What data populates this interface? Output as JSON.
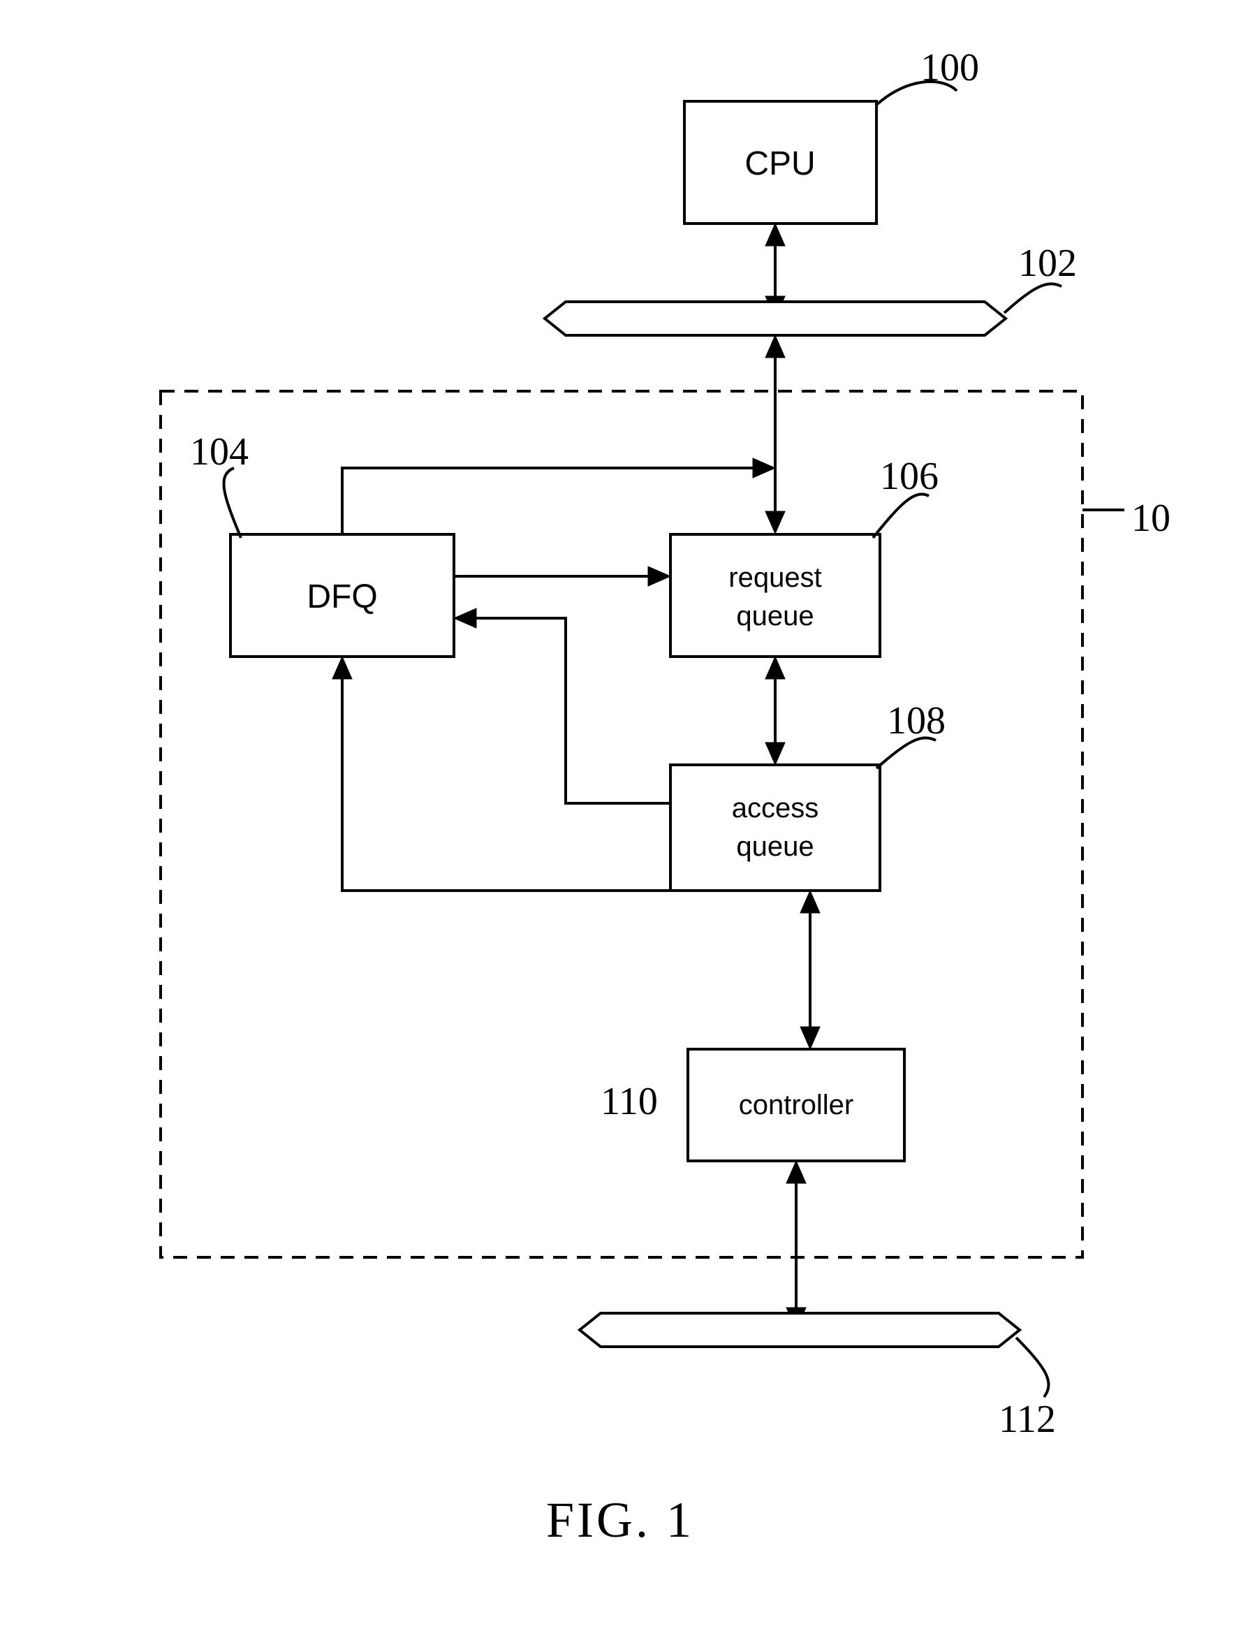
{
  "blocks": {
    "cpu": {
      "label": "CPU",
      "ref": "100"
    },
    "dfq": {
      "label": "DFQ",
      "ref": "104"
    },
    "request_queue": {
      "line1": "request",
      "line2": "queue",
      "ref": "106"
    },
    "access_queue": {
      "line1": "access",
      "line2": "queue",
      "ref": "108"
    },
    "controller": {
      "label": "controller",
      "ref": "110"
    }
  },
  "buses": {
    "top": {
      "ref": "102"
    },
    "bottom": {
      "ref": "112"
    }
  },
  "container": {
    "ref": "10"
  },
  "caption": "FIG. 1"
}
